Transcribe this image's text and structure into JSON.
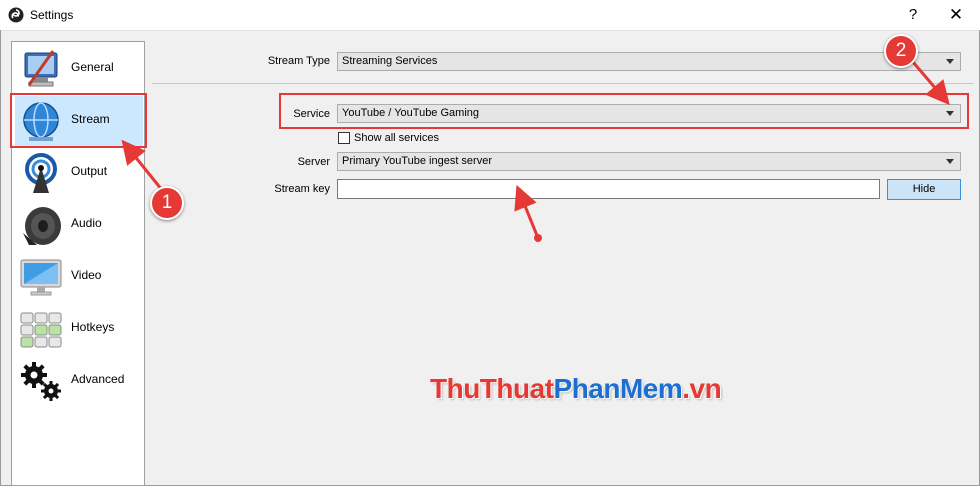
{
  "window": {
    "title": "Settings",
    "help": "?",
    "close": "✕"
  },
  "sidebar": {
    "items": [
      {
        "label": "General",
        "icon": "general-icon"
      },
      {
        "label": "Stream",
        "icon": "stream-globe-icon",
        "selected": true
      },
      {
        "label": "Output",
        "icon": "output-antenna-icon"
      },
      {
        "label": "Audio",
        "icon": "speaker-icon"
      },
      {
        "label": "Video",
        "icon": "monitor-icon"
      },
      {
        "label": "Hotkeys",
        "icon": "keyboard-icon"
      },
      {
        "label": "Advanced",
        "icon": "gears-icon"
      }
    ]
  },
  "stream": {
    "type_label": "Stream Type",
    "type_value": "Streaming Services",
    "service_label": "Service",
    "service_value": "YouTube / YouTube Gaming",
    "show_all_label": "Show all services",
    "show_all_checked": false,
    "server_label": "Server",
    "server_value": "Primary YouTube ingest server",
    "key_label": "Stream key",
    "key_value": "",
    "hide_label": "Hide"
  },
  "annotations": {
    "badge_1": "1",
    "badge_2": "2",
    "color": "#e53935"
  },
  "watermark": {
    "part1": "ThuThuat",
    "part2": "PhanMem",
    "part3": ".vn"
  }
}
